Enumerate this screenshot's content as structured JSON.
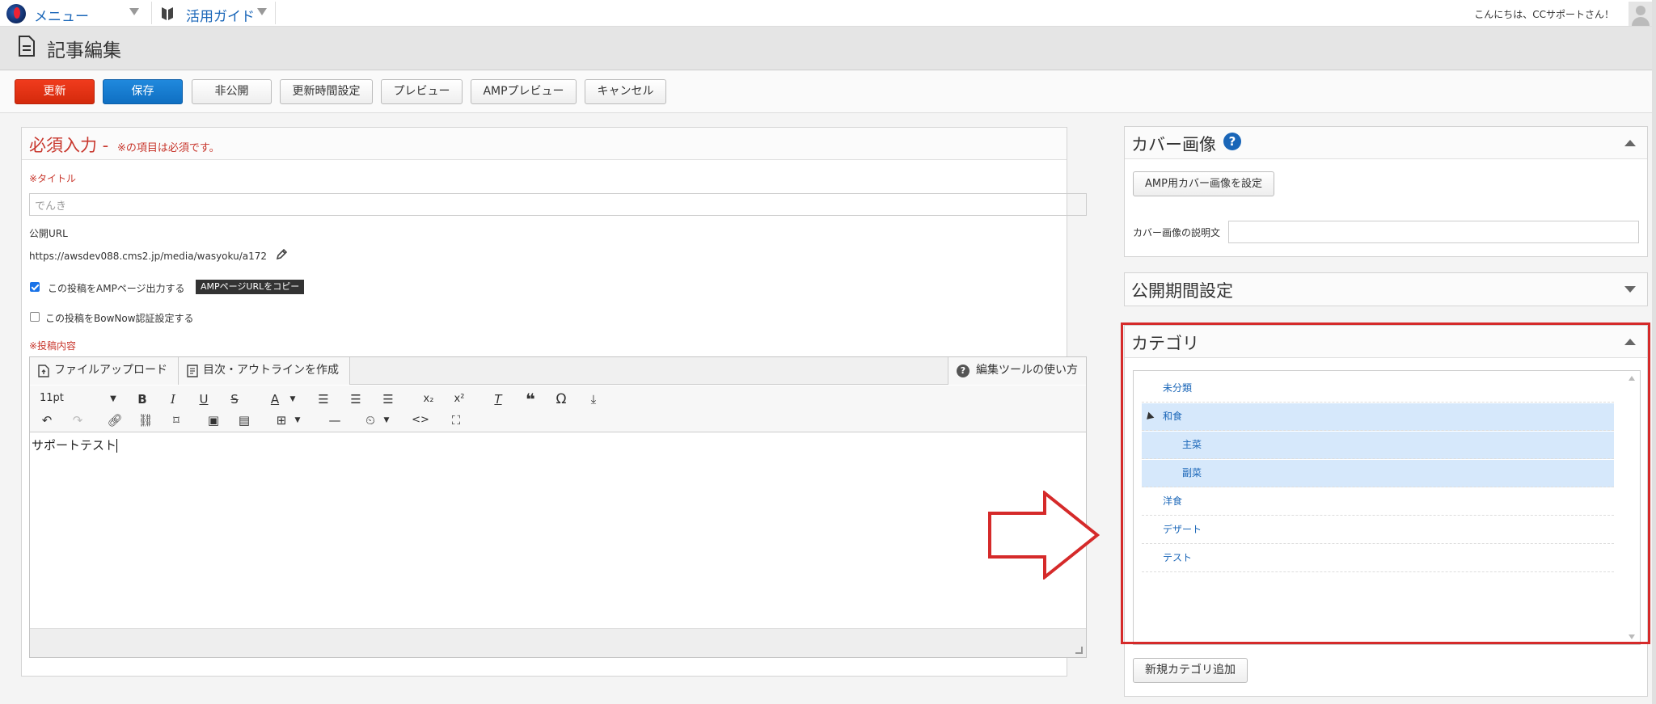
{
  "topbar": {
    "menu_label": "メニュー",
    "guide_label": "活用ガイド",
    "greeting": "こんにちは、CCサポートさん！"
  },
  "page": {
    "title": "記事編集"
  },
  "actions": {
    "update": "更新",
    "save": "保存",
    "unpublish": "非公開",
    "update_time": "更新時間設定",
    "preview": "プレビュー",
    "amp_preview": "AMPプレビュー",
    "cancel": "キャンセル"
  },
  "required": {
    "title": "必須入力 -",
    "note": "※の項目は必須です。",
    "title_label": "※タイトル",
    "title_value": "でんき",
    "url_label": "公開URL",
    "url_value": "https://awsdev088.cms2.jp/media/wasyoku/a172",
    "amp_checkbox_label": "この投稿をAMPページ出力する",
    "amp_copy_button": "AMPページURLをコピー",
    "bownow_checkbox_label": "この投稿をBowNow認証設定する",
    "content_label": "※投稿内容"
  },
  "editor": {
    "tab_upload": "ファイルアップロード",
    "tab_toc": "目次・アウトラインを作成",
    "help_label": "編集ツールの使い方",
    "font_size": "11pt",
    "body_text": "サポートテスト"
  },
  "cover": {
    "title": "カバー画像",
    "amp_button": "AMP用カバー画像を設定",
    "desc_label": "カバー画像の説明文"
  },
  "period": {
    "title": "公開期間設定"
  },
  "category": {
    "title": "カテゴリ",
    "items": [
      {
        "label": "未分類"
      },
      {
        "label": "和食"
      },
      {
        "label": "主菜"
      },
      {
        "label": "副菜"
      },
      {
        "label": "洋食"
      },
      {
        "label": "デザート"
      },
      {
        "label": "テスト"
      }
    ],
    "add_button": "新規カテゴリ追加"
  },
  "colors": {
    "accent_blue": "#1a66b8",
    "update_red": "#e2330f",
    "save_blue": "#1481d3",
    "required_red": "#c8372d",
    "highlight_red": "#d52a2a",
    "selection_blue": "#d6e8fb"
  }
}
